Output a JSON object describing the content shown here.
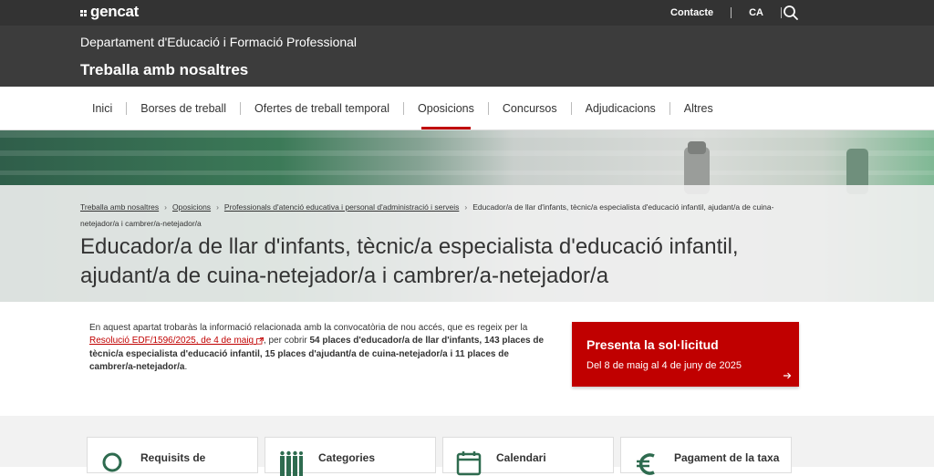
{
  "topbar": {
    "logo_text": "gencat",
    "contact_label": "Contacte",
    "language_label": "CA",
    "search_icon": "search-icon"
  },
  "header": {
    "department": "Departament d'Educació i Formació Professional",
    "section": "Treballa amb nosaltres"
  },
  "nav": {
    "items": [
      {
        "label": "Inici"
      },
      {
        "label": "Borses de treball"
      },
      {
        "label": "Ofertes de treball temporal"
      },
      {
        "label": "Oposicions"
      },
      {
        "label": "Concursos"
      },
      {
        "label": "Adjudicacions"
      },
      {
        "label": "Altres"
      }
    ],
    "active": "Oposicions"
  },
  "breadcrumb": {
    "items": [
      "Treballa amb nosaltres",
      "Oposicions",
      "Professionals d'atenció educativa i personal d'administració i serveis",
      "Educador/a de llar d'infants, tècnic/a especialista d'educació infantil, ajudant/a de cuina-netejador/a i cambrer/a-netejador/a"
    ]
  },
  "page": {
    "title": "Educador/a de llar d'infants, tècnic/a especialista d'educació infantil, ajudant/a de cuina-netejador/a i cambrer/a-netejador/a"
  },
  "intro": {
    "text_before_link": "En aquest apartat trobaràs la informació relacionada amb la convocatòria de nou accés, que es regeix per la ",
    "link_text": "Resolució EDF/1596/2025, de 4 de maig",
    "text_after_link": ", per cobrir ",
    "bold_text": "54 places d'educador/a de llar d'infants, 143 places de tècnic/a especialista d'educació infantil, 15 places d'ajudant/a de cuina-netejador/a i 11 places de cambrer/a-netejador/a",
    "text_end": "."
  },
  "cta": {
    "title": "Presenta la sol·licitud",
    "dates": "Del 8 de maig al 4 de juny de 2025",
    "color": "#c00000"
  },
  "cards": [
    {
      "label": "Requisits de",
      "icon": "magnifier-icon"
    },
    {
      "label": "Categories",
      "icon": "people-icon"
    },
    {
      "label": "Calendari",
      "icon": "calendar-icon"
    },
    {
      "label": "Pagament de la taxa",
      "icon": "euro-icon"
    }
  ]
}
